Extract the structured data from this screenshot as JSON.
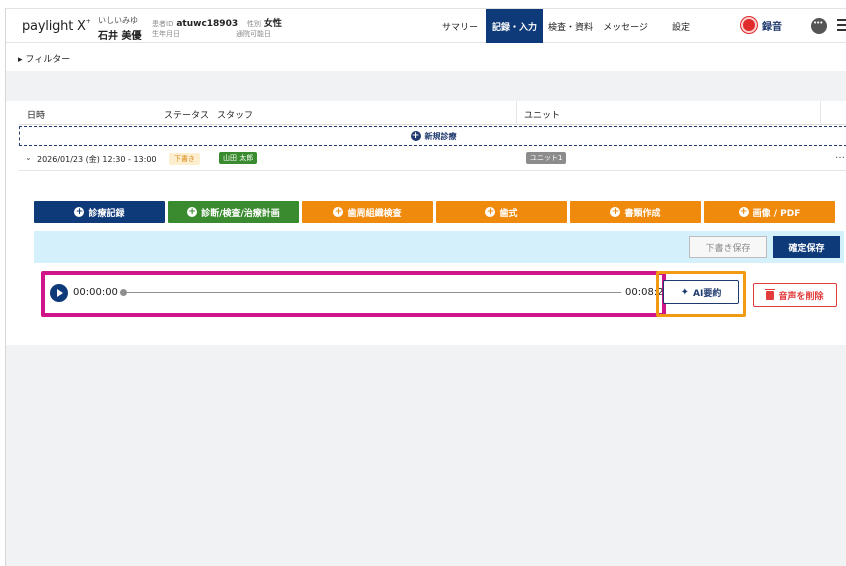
{
  "header": {
    "logo": "paylight X",
    "logo_mark": "+",
    "patient_kana": "いしいみゆ",
    "patient_name": "石井 美優",
    "patient_id_label": "患者ID",
    "patient_id": "atuwc18903",
    "sex_label": "性別",
    "sex": "女性",
    "birth_label": "生年月日",
    "visit_label": "通院可能日",
    "nav": [
      "サマリー",
      "記録・入力",
      "検査・資料",
      "メッセージ",
      "設定"
    ],
    "active_nav": "記録・入力",
    "record_label": "録音",
    "colors": {
      "primary": "#0f3a79",
      "record": "#e12a2a"
    }
  },
  "filter": {
    "label": "フィルター"
  },
  "table": {
    "headers": {
      "date": "日時",
      "status": "ステータス",
      "staff": "スタッフ",
      "unit": "ユニット"
    },
    "new_label": "新規診療",
    "entry": {
      "datetime": "2026/01/23 (金) 12:30 - 13:00",
      "status": "下書き",
      "staff": "山田 太郎",
      "unit": "ユニット1",
      "more": "…"
    }
  },
  "actions": [
    {
      "label": "診療記録",
      "color": "#0f3a79"
    },
    {
      "label": "診断/検査/治療計画",
      "color": "#3a8b2f"
    },
    {
      "label": "歯周組織検査",
      "color": "#ef8a0c"
    },
    {
      "label": "歯式",
      "color": "#ef8a0c"
    },
    {
      "label": "書類作成",
      "color": "#ef8a0c"
    },
    {
      "label": "画像 / PDF",
      "color": "#ef8a0c"
    }
  ],
  "save": {
    "draft_label": "下書き保存",
    "final_label": "確定保存"
  },
  "player": {
    "current": "00:00:00",
    "total": "00:08:2",
    "progress": 0,
    "highlight_color": "#d0148a"
  },
  "ai": {
    "label": "AI要約",
    "highlight_color": "#f29a12"
  },
  "delete": {
    "label": "音声を削除",
    "color": "#e23b3b"
  }
}
